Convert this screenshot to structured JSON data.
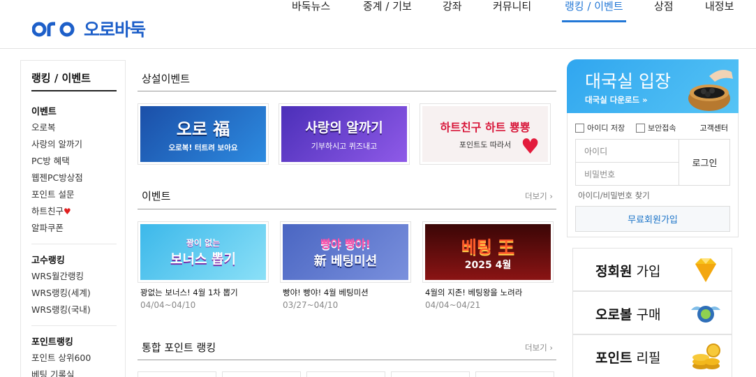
{
  "brand": {
    "name": "오로바둑",
    "color": "#1d5fc9",
    "accent": "#2277d6"
  },
  "nav": [
    {
      "label": "바둑뉴스",
      "active": false
    },
    {
      "label": "중계 / 기보",
      "active": false
    },
    {
      "label": "강좌",
      "active": false
    },
    {
      "label": "커뮤니티",
      "active": false
    },
    {
      "label": "랭킹 / 이벤트",
      "active": true
    },
    {
      "label": "상점",
      "active": false
    },
    {
      "label": "내정보",
      "active": false
    }
  ],
  "sidebar": {
    "title": "랭킹 / 이벤트",
    "groups": [
      {
        "head": "이벤트",
        "items": [
          "오로복",
          "사랑의 알까기",
          "PC방 혜택",
          "웹젠PC방상점",
          "포인트 설문",
          "하트친구",
          "알파쿠폰"
        ]
      },
      {
        "head": "고수랭킹",
        "items": [
          "WRS월간랭킹",
          "WRS랭킹(세계)",
          "WRS랭킹(국내)"
        ]
      },
      {
        "head": "포인트랭킹",
        "items": [
          "포인트 상위600",
          "베팅 기록실"
        ]
      }
    ]
  },
  "main": {
    "permanent": {
      "title": "상설이벤트",
      "banners": [
        {
          "line1": "오로 福",
          "line2": "오로복! 터트려 보아요",
          "bg": "#1c5fb0"
        },
        {
          "line1": "사랑의 알까기",
          "line2": "기부하시고 퀴즈내고",
          "bg": "#6a3fc9"
        },
        {
          "line1": "하트친구 하트 뿅뿅",
          "line2": "포인트도 따라서",
          "bg": "#f7f2f2"
        }
      ]
    },
    "events": {
      "title": "이벤트",
      "more": "더보기 ›",
      "items": [
        {
          "banner1": "꽝이 없는",
          "banner2": "보너스 뽑기",
          "title": "꽝없는 보너스! 4월 1차 뽑기",
          "date": "04/04~04/10",
          "bg": "#4fc4ee"
        },
        {
          "banner1": "빵야 빵야!",
          "banner2": "新 베팅미션",
          "title": "빵야! 빵야! 4월 베팅미션",
          "date": "03/27~04/10",
          "bg": "#5a73c8"
        },
        {
          "banner1": "베팅 王",
          "banner2": "2025 4월",
          "title": "4월의 지존! 베팅왕을 노려라",
          "date": "04/04~04/21",
          "bg": "#7a1010"
        }
      ]
    },
    "points": {
      "title": "통합 포인트 랭킹",
      "more": "더보기 ›"
    }
  },
  "right": {
    "enter": {
      "title": "대국실 입장",
      "sub": "대국실 다운로드 »"
    },
    "login": {
      "save_id": "아이디 저장",
      "secure": "보안접속",
      "cs": "고객센터",
      "id_placeholder": "아이디",
      "pw_placeholder": "비밀번호",
      "login_button": "로그인",
      "find": "아이디/비밀번호 찾기",
      "join": "무료회원가입"
    },
    "promos": [
      {
        "bold": "정회원",
        "rest": " 가입",
        "icon": "diamond-icon"
      },
      {
        "bold": "오로볼",
        "rest": " 구매",
        "icon": "winged-ball-icon"
      },
      {
        "bold": "포인트",
        "rest": " 리필",
        "icon": "coins-icon"
      }
    ]
  }
}
